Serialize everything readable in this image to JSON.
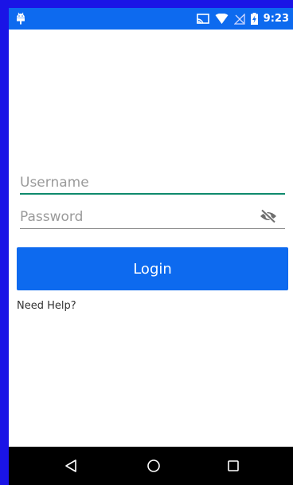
{
  "status_bar": {
    "time": "9:23",
    "icons": [
      "android-icon",
      "cast-icon",
      "wifi-icon",
      "no-signal-icon",
      "battery-charging-icon"
    ]
  },
  "login_form": {
    "username_placeholder": "Username",
    "username_value": "",
    "password_placeholder": "Password",
    "password_value": "",
    "visibility_icon": "eye-off-icon",
    "login_label": "Login",
    "help_label": "Need Help?"
  },
  "nav_bar": {
    "icons": [
      "back-icon",
      "home-icon",
      "recents-icon"
    ]
  },
  "colors": {
    "accent": "#0d6aef",
    "outer_border": "#1a14e6",
    "focus_underline": "#0f8a6d"
  }
}
